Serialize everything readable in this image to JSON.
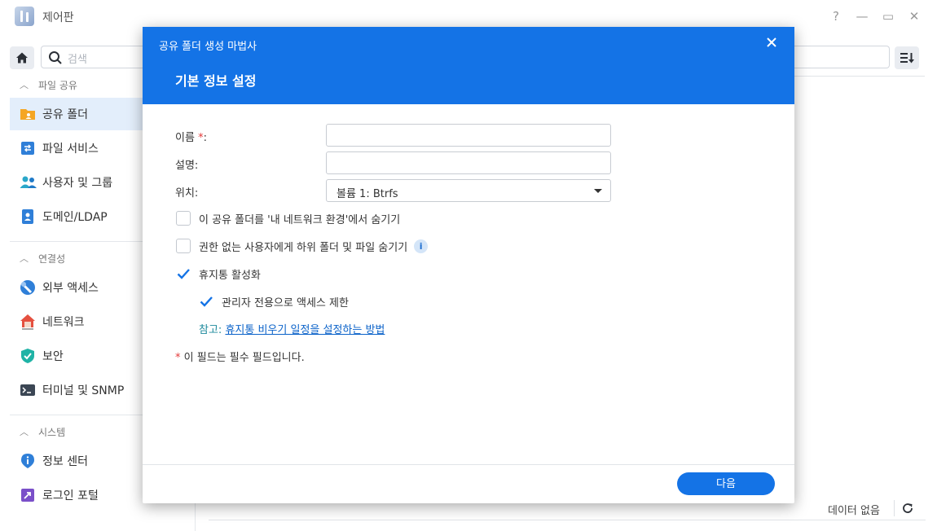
{
  "window": {
    "title": "제어판",
    "controls": {
      "help": "?",
      "minimize": "—",
      "maximize": "▭",
      "close": "✕"
    }
  },
  "toolbar": {
    "search_placeholder": "검색"
  },
  "sidebar": {
    "sections": [
      {
        "label": "파일 공유",
        "items": [
          {
            "label": "공유 폴더",
            "icon": "shared-folder-icon",
            "active": true
          },
          {
            "label": "파일 서비스",
            "icon": "file-services-icon"
          },
          {
            "label": "사용자 및 그룹",
            "icon": "users-groups-icon"
          },
          {
            "label": "도메인/LDAP",
            "icon": "domain-ldap-icon"
          }
        ]
      },
      {
        "label": "연결성",
        "items": [
          {
            "label": "외부 액세스",
            "icon": "external-access-icon"
          },
          {
            "label": "네트워크",
            "icon": "network-icon"
          },
          {
            "label": "보안",
            "icon": "security-shield-icon"
          },
          {
            "label": "터미널 및 SNMP",
            "icon": "terminal-icon"
          }
        ]
      },
      {
        "label": "시스템",
        "items": [
          {
            "label": "정보 센터",
            "icon": "info-center-icon"
          },
          {
            "label": "로그인 포털",
            "icon": "login-portal-icon"
          }
        ]
      }
    ]
  },
  "main": {
    "status": "데이터 없음"
  },
  "dialog": {
    "title": "공유 폴더 생성 마법사",
    "step_title": "기본 정보 설정",
    "fields": {
      "name_label": "이름",
      "name_required_mark": "*",
      "name_suffix": ":",
      "name_value": "",
      "description_label": "설명:",
      "description_value": "",
      "location_label": "위치:",
      "location_value": "볼륨 1:  Btrfs"
    },
    "checkboxes": {
      "hide_network": {
        "label": "이 공유 폴더를 '내 네트워크 환경'에서 숨기기",
        "checked": false
      },
      "hide_subfolders": {
        "label": "권한 없는 사용자에게 하위 폴더 및 파일 숨기기",
        "checked": false
      },
      "recycle_bin": {
        "label": "휴지통 활성화",
        "checked": true
      },
      "admin_only": {
        "label": "관리자 전용으로 액세스 제한",
        "checked": true
      }
    },
    "note_prefix": "참고:",
    "note_link": "휴지통 비우기 일정을 설정하는 방법",
    "required_mark": "*",
    "required_note": "이 필드는 필수 필드입니다.",
    "next_label": "다음",
    "info_glyph": "i"
  },
  "colors": {
    "accent": "#1473e6",
    "active_nav_bg": "#e3eefb",
    "required": "#e43b3b",
    "link": "#0a62c9"
  }
}
